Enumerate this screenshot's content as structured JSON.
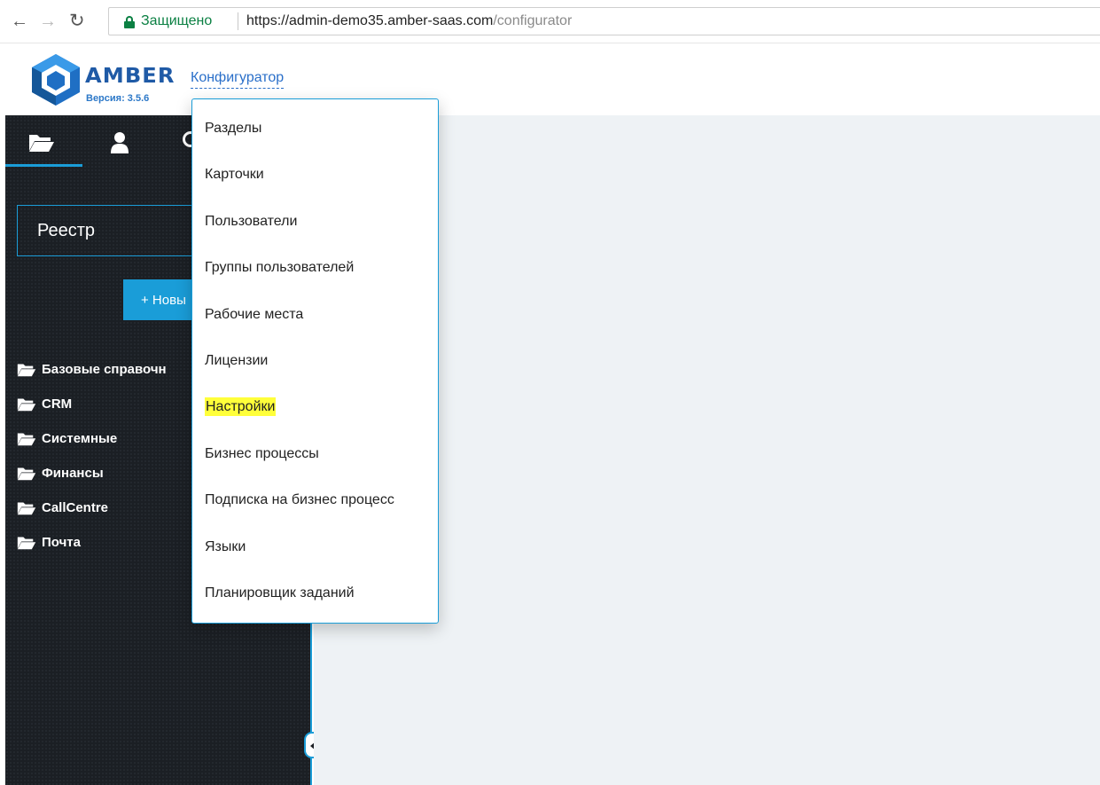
{
  "browser": {
    "secure_label": "Защищено",
    "url_host": "https://admin-demo35.amber-saas.com",
    "url_path": "/configurator"
  },
  "header": {
    "logo_text": "AMBER",
    "version": "Версия: 3.5.6",
    "configurator_link": "Конфигуратор"
  },
  "sidebar": {
    "registry_value": "Реестр",
    "new_button_label": "+ Новы",
    "tree": [
      {
        "label": "Базовые справочн"
      },
      {
        "label": "CRM"
      },
      {
        "label": "Системные"
      },
      {
        "label": "Финансы"
      },
      {
        "label": "CallCentre"
      },
      {
        "label": "Почта"
      }
    ]
  },
  "dropdown": {
    "items": [
      {
        "label": "Разделы"
      },
      {
        "label": "Карточки"
      },
      {
        "label": "Пользователи"
      },
      {
        "label": "Группы пользователей"
      },
      {
        "label": "Рабочие места"
      },
      {
        "label": "Лицензии"
      },
      {
        "label": "Настройки",
        "highlighted": true
      },
      {
        "label": "Бизнес процессы"
      },
      {
        "label": "Подписка на бизнес процесс"
      },
      {
        "label": "Языки"
      },
      {
        "label": "Планировщик заданий"
      }
    ]
  },
  "colors": {
    "accent": "#1a9dd8",
    "sidebar_bg": "#1b1f24",
    "highlight": "#ffff3a",
    "link": "#2a6fc9"
  }
}
